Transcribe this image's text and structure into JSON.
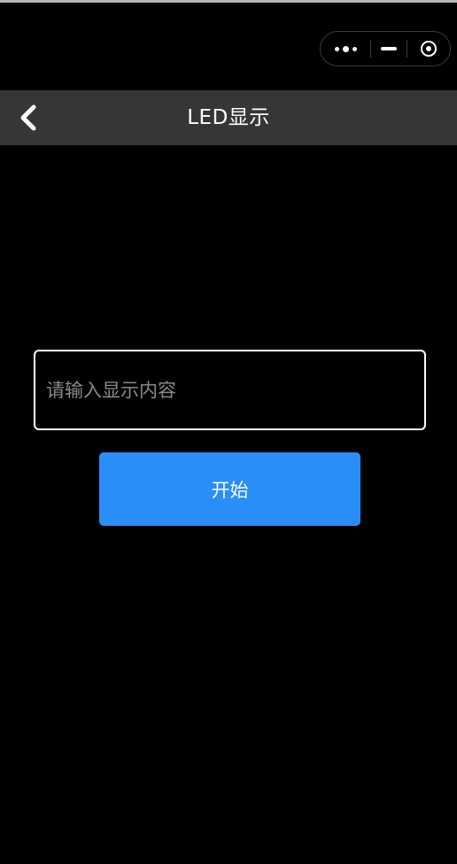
{
  "window": {
    "capsule": {
      "more_icon": "more-dots-icon",
      "minimize_icon": "minimize-icon",
      "close_icon": "target-close-icon"
    }
  },
  "navbar": {
    "title": "LED显示",
    "back_icon": "chevron-left-icon",
    "background_color": "#363636"
  },
  "form": {
    "input": {
      "value": "",
      "placeholder": "请输入显示内容"
    },
    "start_button": {
      "label": "开始",
      "color": "#2a8ef9"
    }
  },
  "theme": {
    "background": "#000000",
    "text": "#ffffff"
  }
}
